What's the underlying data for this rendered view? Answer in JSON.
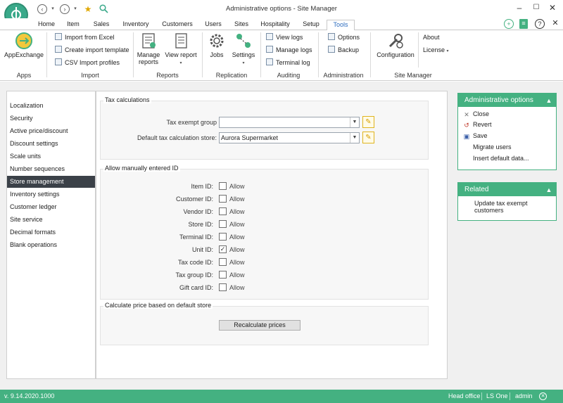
{
  "window": {
    "title": "Administrative options - Site Manager",
    "quick_access_icons": [
      "back-icon",
      "forward-icon",
      "favorite-icon",
      "search-icon"
    ],
    "controls": [
      "minimize-icon",
      "maximize-icon",
      "close-icon"
    ]
  },
  "tabs": [
    {
      "label": "Home"
    },
    {
      "label": "Item"
    },
    {
      "label": "Sales"
    },
    {
      "label": "Inventory"
    },
    {
      "label": "Customers"
    },
    {
      "label": "Users"
    },
    {
      "label": "Sites"
    },
    {
      "label": "Hospitality"
    },
    {
      "label": "Setup"
    },
    {
      "label": "Tools",
      "active": true
    }
  ],
  "ribbon": {
    "apps": {
      "group": "Apps",
      "app_exchange": "AppExchange"
    },
    "import": {
      "group": "Import",
      "import_excel": "Import from Excel",
      "create_template": "Create import template",
      "csv_profiles": "CSV Import profiles"
    },
    "reports": {
      "group": "Reports",
      "manage_reports": "Manage reports",
      "view_report": "View report"
    },
    "replication": {
      "group": "Replication",
      "jobs": "Jobs",
      "settings": "Settings"
    },
    "auditing": {
      "group": "Auditing",
      "view_logs": "View logs",
      "manage_logs": "Manage logs",
      "terminal_log": "Terminal log"
    },
    "administration": {
      "group": "Administration",
      "options": "Options",
      "backup": "Backup"
    },
    "site_manager": {
      "group": "Site Manager",
      "configuration": "Configuration",
      "about": "About",
      "license": "License"
    }
  },
  "nav": {
    "items": [
      {
        "label": "Localization"
      },
      {
        "label": "Security"
      },
      {
        "label": "Active price/discount"
      },
      {
        "label": "Discount settings"
      },
      {
        "label": "Scale units"
      },
      {
        "label": "Number sequences"
      },
      {
        "label": "Store management",
        "selected": true
      },
      {
        "label": "Inventory settings"
      },
      {
        "label": "Customer ledger"
      },
      {
        "label": "Site service"
      },
      {
        "label": "Decimal formats"
      },
      {
        "label": "Blank operations"
      }
    ]
  },
  "tax": {
    "title": "Tax calculations",
    "exempt_group_label": "Tax exempt group",
    "exempt_group_value": "",
    "default_store_label": "Default tax calculation store:",
    "default_store_value": "Aurora Supermarket"
  },
  "ids": {
    "title": "Allow manually entered ID",
    "allow_text": "Allow",
    "rows": [
      {
        "label": "Item ID:",
        "checked": false
      },
      {
        "label": "Customer ID:",
        "checked": false
      },
      {
        "label": "Vendor ID:",
        "checked": false
      },
      {
        "label": "Store ID:",
        "checked": false
      },
      {
        "label": "Terminal ID:",
        "checked": false
      },
      {
        "label": "Unit ID:",
        "checked": true
      },
      {
        "label": "Tax code ID:",
        "checked": false
      },
      {
        "label": "Tax group ID:",
        "checked": false
      },
      {
        "label": "Gift card ID:",
        "checked": false
      }
    ]
  },
  "recalc": {
    "title": "Calculate price based on default store",
    "button": "Recalculate prices"
  },
  "admin_panel": {
    "title": "Administrative options",
    "actions": [
      {
        "label": "Close",
        "icon": "close-icon"
      },
      {
        "label": "Revert",
        "icon": "revert-icon"
      },
      {
        "label": "Save",
        "icon": "save-icon"
      },
      {
        "label": "Migrate users",
        "icon": ""
      },
      {
        "label": "Insert default data...",
        "icon": ""
      }
    ]
  },
  "related_panel": {
    "title": "Related",
    "actions": [
      {
        "label_line1": "Update tax exempt",
        "label_line2": "customers"
      }
    ]
  },
  "status": {
    "version": "v. 9.14.2020.1000",
    "site": "Head office",
    "product": "LS One",
    "user": "admin"
  },
  "colors": {
    "accent": "#44b181",
    "nav_selected": "#3b4148",
    "active_tab": "#2e6dbf",
    "edit_icon": "#e0b41e"
  }
}
